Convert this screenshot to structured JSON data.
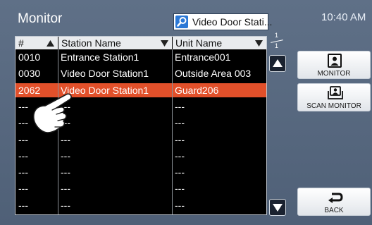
{
  "header": {
    "title": "Monitor",
    "search_text": "Video Door Stati...",
    "time": "10:40 AM"
  },
  "table": {
    "columns": [
      "#",
      "Station Name",
      "Unit Name"
    ],
    "rows": [
      {
        "id": "0010",
        "station": "Entrance Station1",
        "unit": "Entrance001",
        "selected": false
      },
      {
        "id": "0030",
        "station": "Video Door Station1",
        "unit": "Outside Area 003",
        "selected": false
      },
      {
        "id": "2062",
        "station": "Video Door Station1",
        "unit": "Guard206",
        "selected": true
      },
      {
        "id": "---",
        "station": "---",
        "unit": "---",
        "selected": false
      },
      {
        "id": "---",
        "station": "---",
        "unit": "---",
        "selected": false
      },
      {
        "id": "---",
        "station": "---",
        "unit": "---",
        "selected": false
      },
      {
        "id": "---",
        "station": "---",
        "unit": "---",
        "selected": false
      },
      {
        "id": "---",
        "station": "---",
        "unit": "---",
        "selected": false
      },
      {
        "id": "---",
        "station": "---",
        "unit": "---",
        "selected": false
      },
      {
        "id": "---",
        "station": "---",
        "unit": "---",
        "selected": false
      }
    ]
  },
  "pagination": {
    "current": "1",
    "total": "1"
  },
  "buttons": {
    "monitor": "MONITOR",
    "scan_monitor": "SCAN MONITOR",
    "back": "BACK"
  },
  "colors": {
    "background": "#576880",
    "selected_row": "#e2502a",
    "search_icon": "#2b78d6"
  }
}
